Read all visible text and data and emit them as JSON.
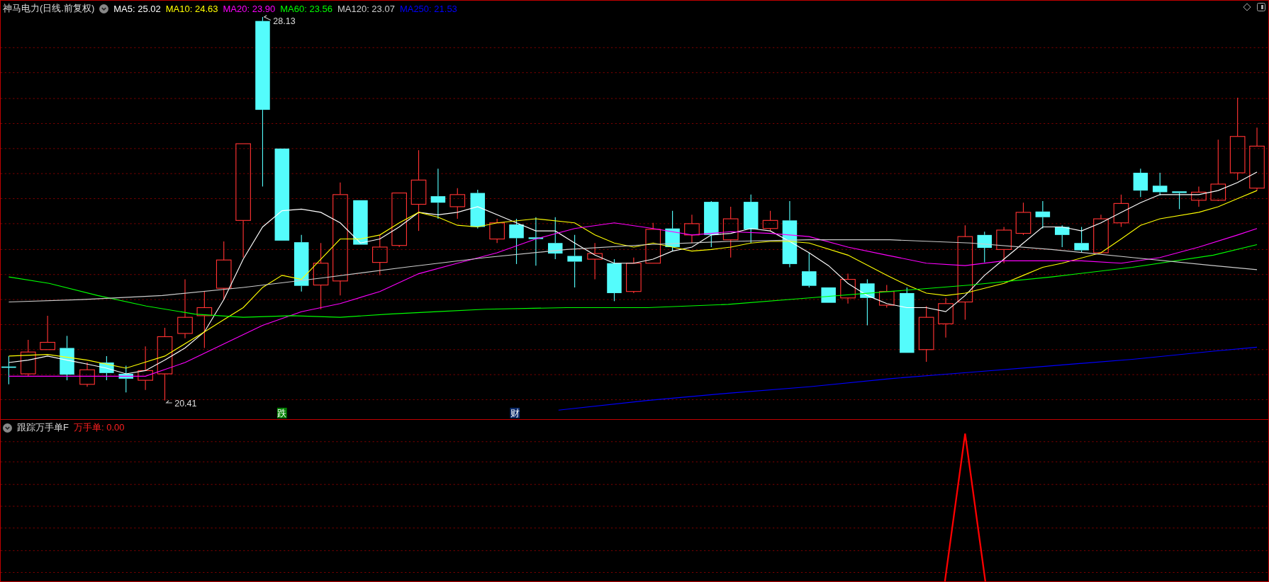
{
  "header": {
    "title": "神马电力(日线.前复权)",
    "ma": [
      {
        "label": "MA5: 25.02",
        "color": "#ffffff"
      },
      {
        "label": "MA10: 24.63",
        "color": "#ffff00"
      },
      {
        "label": "MA20: 23.90",
        "color": "#ff00ff"
      },
      {
        "label": "MA60: 23.56",
        "color": "#00ff00"
      },
      {
        "label": "MA120: 23.07",
        "color": "#cccccc"
      },
      {
        "label": "MA250: 21.53",
        "color": "#0000ff"
      }
    ]
  },
  "chart": {
    "high_label": "28.13",
    "low_label": "20.41",
    "events": [
      {
        "label": "跌",
        "color": "#008000"
      },
      {
        "label": "财",
        "color": "#0a2a6a"
      }
    ]
  },
  "indicator": {
    "title": "跟踪万手单F",
    "reading": "万手单: 0.00"
  }
}
